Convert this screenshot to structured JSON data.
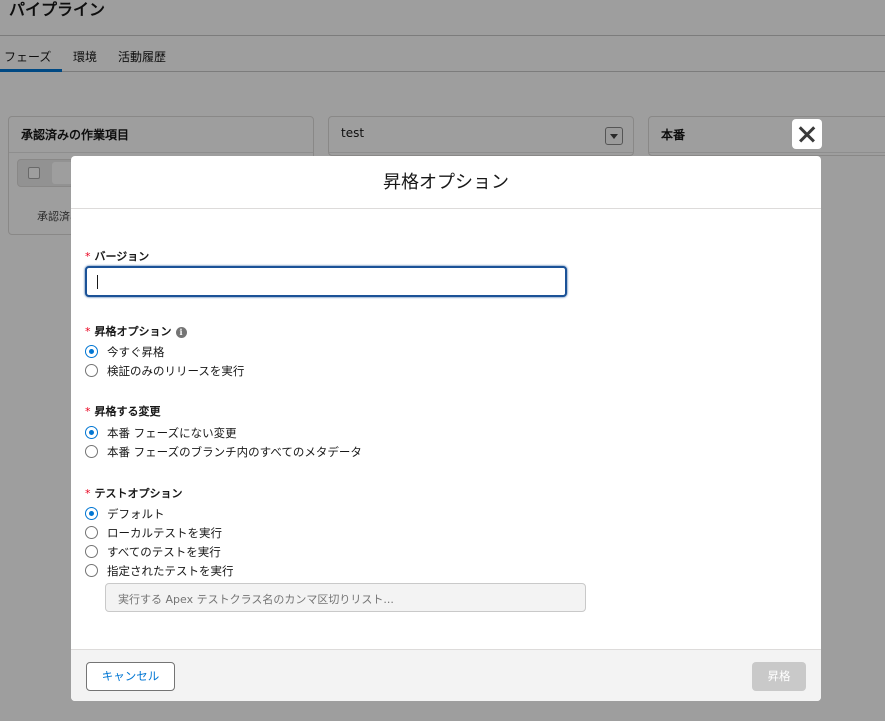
{
  "page": {
    "title": "パイプライン",
    "tabs": [
      {
        "label": "フェーズ",
        "active": true
      },
      {
        "label": "環境",
        "active": false
      },
      {
        "label": "活動履歴",
        "active": false
      }
    ]
  },
  "stages": [
    {
      "name": "承認済みの作業項目",
      "body_text": "承認済み"
    },
    {
      "name": "test"
    },
    {
      "name": "本番"
    }
  ],
  "modal": {
    "title": "昇格オプション",
    "version": {
      "required_mark": "*",
      "label": "バージョン",
      "value": ""
    },
    "promote_option": {
      "required_mark": "*",
      "label": "昇格オプション",
      "info_icon": "i",
      "options": [
        {
          "label": "今すぐ昇格",
          "checked": true
        },
        {
          "label": "検証のみのリリースを実行",
          "checked": false
        }
      ]
    },
    "changes": {
      "required_mark": "*",
      "label": "昇格する変更",
      "options": [
        {
          "label": "本番 フェーズにない変更",
          "checked": true
        },
        {
          "label": "本番 フェーズのブランチ内のすべてのメタデータ",
          "checked": false
        }
      ]
    },
    "test_option": {
      "required_mark": "*",
      "label": "テストオプション",
      "options": [
        {
          "label": "デフォルト",
          "checked": true
        },
        {
          "label": "ローカルテストを実行",
          "checked": false
        },
        {
          "label": "すべてのテストを実行",
          "checked": false
        },
        {
          "label": "指定されたテストを実行",
          "checked": false
        }
      ],
      "specified_tests_placeholder": "実行する Apex テストクラス名のカンマ区切りリスト..."
    },
    "footer": {
      "cancel_label": "キャンセル",
      "promote_label": "昇格"
    }
  },
  "colors": {
    "brand": "#0176d3",
    "required": "#ea001e",
    "focus_border": "#1b5297",
    "disabled_button": "#c9c9c9"
  }
}
